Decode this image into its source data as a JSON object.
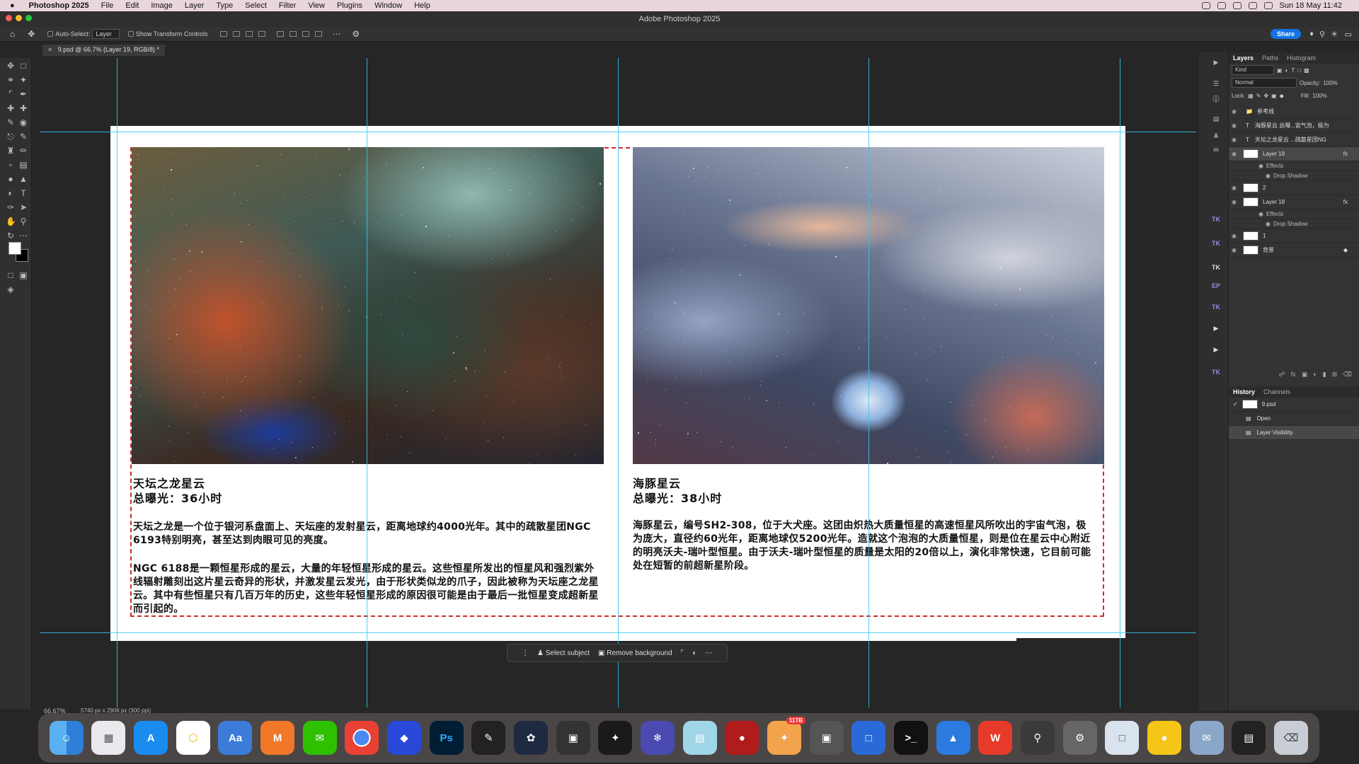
{
  "menubar": {
    "app": "Photoshop 2025",
    "items": [
      "File",
      "Edit",
      "Image",
      "Layer",
      "Type",
      "Select",
      "Filter",
      "View",
      "Plugins",
      "Window",
      "Help"
    ],
    "datetime": "Sun 18 May  11:42"
  },
  "window": {
    "title": "Adobe Photoshop 2025"
  },
  "options": {
    "auto_select": "Auto-Select:",
    "auto_select_value": "Layer",
    "show_transform": "Show Transform Controls",
    "share": "Share"
  },
  "doc_tab": "9.psd @ 66.7% (Layer 19, RGB/8) *",
  "canvas": {
    "left": {
      "title": "天坛之龙星云",
      "exposure": "总曝光：36小时",
      "p1": "天坛之龙是一个位于银河系盘面上、天坛座的发射星云，距离地球约4000光年。其中的疏散星团NGC 6193特别明亮，甚至达到肉眼可见的亮度。",
      "p2": "NGC 6188是一颗恒星形成的星云，大量的年轻恒星形成的星云。这些恒星所发出的恒星风和强烈紫外线辐射雕刻出这片星云奇异的形状，并激发星云发光，由于形状类似龙的爪子，因此被称为天坛座之龙星云。其中有些恒星只有几百万年的历史，这些年轻恒星形成的原因很可能是由于最后一批恒星变成超新星而引起的。"
    },
    "right": {
      "title": "海豚星云",
      "exposure": "总曝光：38小时",
      "p1": "海豚星云，编号SH2-308，位于大犬座。这团由炽热大质量恒星的高速恒星风所吹出的宇宙气泡，极为庞大，直径约60光年，距离地球仅5200光年。造就这个泡泡的大质量恒星，则是位在星云中心附近的明亮沃夫-瑞叶型恒星。由于沃夫-瑞叶型恒星的质量是太阳的20倍以上，演化非常快速，它目前可能处在短暂的前超新星阶段。"
    }
  },
  "contextbar": {
    "select_subject": "Select subject",
    "remove_bg": "Remove background"
  },
  "status": {
    "zoom": "66.67%",
    "size": "5740 px x 2906 px (300 ppi)"
  },
  "layers_panel": {
    "tabs": [
      "Layers",
      "Paths",
      "Histogram"
    ],
    "kind": "Kind",
    "blend": "Normal",
    "opacity_label": "Opacity:",
    "opacity": "100%",
    "lock": "Lock:",
    "fill_label": "Fill:",
    "fill": "100%",
    "layers": [
      {
        "name": "参考线",
        "type": "group"
      },
      {
        "name": "海豚星云 总曝...宙气泡，极为",
        "type": "text"
      },
      {
        "name": "天坛之龙星云 ...疏散星团NG",
        "type": "text"
      },
      {
        "name": "Layer 19",
        "type": "image",
        "fx": "fx"
      },
      {
        "name": "Effects",
        "type": "sub"
      },
      {
        "name": "Drop Shadow",
        "type": "sub2"
      },
      {
        "name": "2",
        "type": "image"
      },
      {
        "name": "Layer 18",
        "type": "image",
        "fx": "fx"
      },
      {
        "name": "Effects",
        "type": "sub"
      },
      {
        "name": "Drop Shadow",
        "type": "sub2"
      },
      {
        "name": "1",
        "type": "image"
      },
      {
        "name": "背景",
        "type": "image"
      }
    ]
  },
  "history_panel": {
    "tabs": [
      "History",
      "Channels"
    ],
    "items": [
      "9.psd",
      "Open",
      "Layer Visibility"
    ]
  },
  "dock": {
    "items": [
      "Finder",
      "Launchpad",
      "App Store",
      "Notes",
      "Dictionary",
      "Mango",
      "WeChat",
      "Chrome",
      "Vector",
      "Ps",
      "Final Cut",
      "DaVinci",
      "Time Lapse",
      "Instruments",
      "Weather",
      "Files",
      "Photo Booth",
      "Calendar",
      "Screenshot",
      "Keynote",
      "Terminal",
      "Motion",
      "WPS",
      "QuickTime",
      "Settings",
      "Preview",
      "Tips",
      "Mail",
      "Photoshop PDF",
      "Trash"
    ],
    "badge": "11TB"
  }
}
